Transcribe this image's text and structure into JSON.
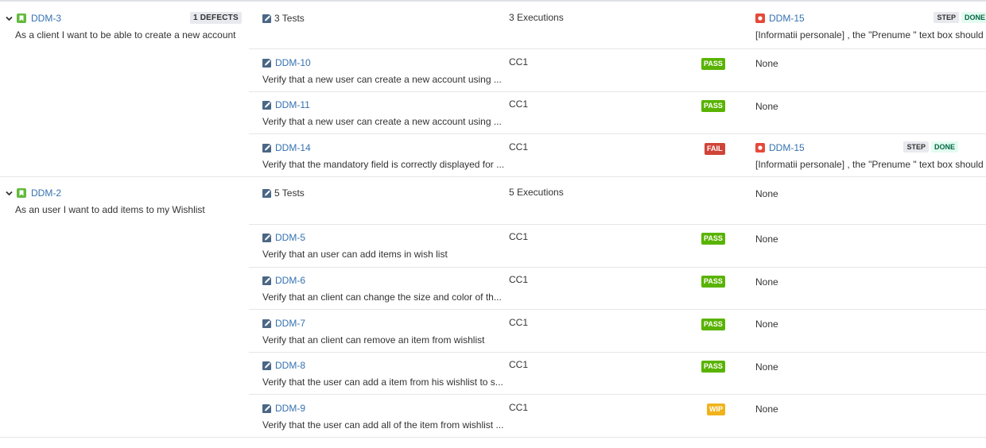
{
  "colors": {
    "link": "#3572b0",
    "pass": "#59b300",
    "fail": "#d04437",
    "wip": "#f0b31c",
    "story_icon": "#63ba3c",
    "bug_icon": "#e5493a",
    "test_icon": "#4a6785"
  },
  "icons": {
    "chevron": "chevron-down-icon",
    "story": "story-icon",
    "test": "test-icon",
    "bug": "bug-icon"
  },
  "stories": [
    {
      "key": "DDM-3",
      "summary": "As a client I want to be able to create a new account",
      "defects_badge": "1 DEFECTS",
      "tests_label": "3 Tests",
      "executions_label": "3 Executions",
      "summary_defect": {
        "key": "DDM-15",
        "summary": "[Informatii personale] , the \"Prenume \" text box should ...",
        "step": "STEP",
        "done": "DONE"
      },
      "tests": [
        {
          "key": "DDM-10",
          "summary": "Verify that a new user can create a new account using ...",
          "env": "CC1",
          "status": "PASS",
          "defect": "None"
        },
        {
          "key": "DDM-11",
          "summary": "Verify that a new user can create a new account using ...",
          "env": "CC1",
          "status": "PASS",
          "defect": "None"
        },
        {
          "key": "DDM-14",
          "summary": "Verify that the mandatory field is correctly displayed for ...",
          "env": "CC1",
          "status": "FAIL",
          "defect_key": "DDM-15",
          "defect_summary": "[Informatii personale] , the \"Prenume \" text box should ...",
          "step": "STEP",
          "done": "DONE"
        }
      ]
    },
    {
      "key": "DDM-2",
      "summary": "As an user I want to add items to my Wishlist",
      "tests_label": "5 Tests",
      "executions_label": "5 Executions",
      "summary_defect_none": "None",
      "tests": [
        {
          "key": "DDM-5",
          "summary": "Verify that an user can add items in wish list",
          "env": "CC1",
          "status": "PASS",
          "defect": "None"
        },
        {
          "key": "DDM-6",
          "summary": "Verify that an client can change the size and color of th...",
          "env": "CC1",
          "status": "PASS",
          "defect": "None"
        },
        {
          "key": "DDM-7",
          "summary": "Verify that an client can remove an item from wishlist",
          "env": "CC1",
          "status": "PASS",
          "defect": "None"
        },
        {
          "key": "DDM-8",
          "summary": "Verify that the user can add a item from his wishlist to s...",
          "env": "CC1",
          "status": "PASS",
          "defect": "None"
        },
        {
          "key": "DDM-9",
          "summary": "Verify that the user can add all of the item from wishlist ...",
          "env": "CC1",
          "status": "WIP",
          "defect": "None"
        }
      ]
    }
  ]
}
